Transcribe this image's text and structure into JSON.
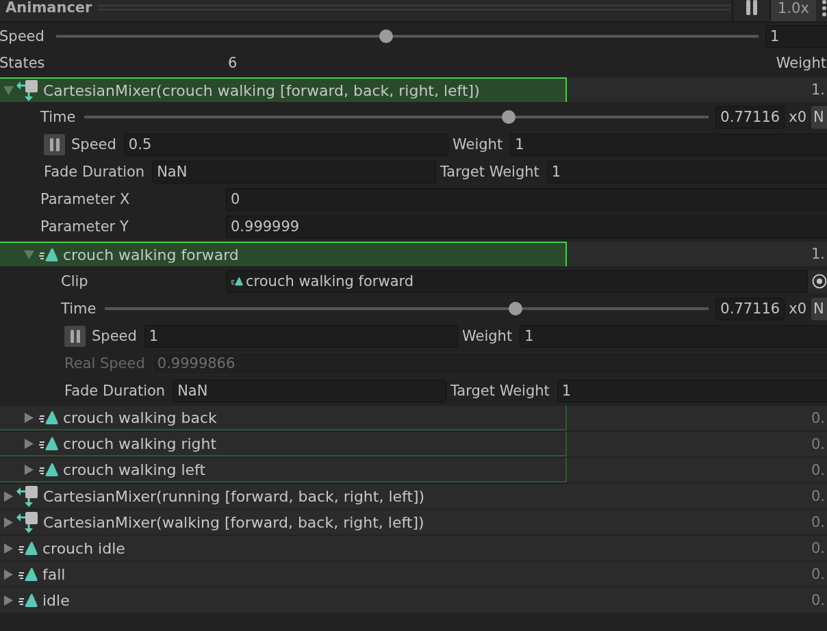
{
  "header": {
    "title": "Animancer",
    "speed_button": "1.0x"
  },
  "speed": {
    "label": "Speed",
    "level": 0.47,
    "value": "1"
  },
  "summary": {
    "label": "States",
    "count": "6",
    "weight_header": "Weight"
  },
  "states": [
    {
      "kind": "mixer",
      "name": "CartesianMixer(crouch walking [forward, back, right, left])",
      "weight": "1.",
      "expanded": true,
      "playing": true,
      "outlined": false,
      "fields": [
        {
          "kind": "time",
          "label": "Time",
          "level": 0.68,
          "value": "0.77116",
          "multiplier": "x0",
          "button": "N",
          "disabled": false
        },
        {
          "kind": "speed",
          "label": "Speed",
          "value": "0.5",
          "weight_label": "Weight",
          "weight": "1",
          "disabled": false
        },
        {
          "kind": "fade",
          "label": "Fade Duration",
          "value": "NaN",
          "target_label": "Target Weight",
          "target": "1",
          "disabled": false
        },
        {
          "kind": "parameter",
          "label": "Parameter X",
          "value": "0",
          "disabled": false
        },
        {
          "kind": "parameter",
          "label": "Parameter Y",
          "value": "0.999999",
          "disabled": false
        }
      ],
      "children": [
        {
          "kind": "clip",
          "name": "crouch walking forward",
          "weight": "1.",
          "expanded": true,
          "playing": true,
          "outlined": false,
          "fields": [
            {
              "kind": "clip",
              "label": "Clip",
              "value": "crouch walking forward",
              "disabled": false
            },
            {
              "kind": "time",
              "label": "Time",
              "level": 0.68,
              "value": "0.77116",
              "multiplier": "x0",
              "button": "N",
              "disabled": false
            },
            {
              "kind": "speed",
              "label": "Speed",
              "value": "1",
              "weight_label": "Weight",
              "weight": "1",
              "disabled": false
            },
            {
              "kind": "inline",
              "label": "Real Speed",
              "value": "0.9999866",
              "disabled": true
            },
            {
              "kind": "fade",
              "label": "Fade Duration",
              "value": "NaN",
              "target_label": "Target Weight",
              "target": "1",
              "disabled": false
            }
          ]
        },
        {
          "kind": "clip",
          "name": "crouch walking back",
          "weight": "0.",
          "expanded": false,
          "playing": false,
          "outlined": true
        },
        {
          "kind": "clip",
          "name": "crouch walking right",
          "weight": "0.",
          "expanded": false,
          "playing": false,
          "outlined": true
        },
        {
          "kind": "clip",
          "name": "crouch walking left",
          "weight": "0.",
          "expanded": false,
          "playing": false,
          "outlined": true
        }
      ]
    },
    {
      "kind": "mixer",
      "name": "CartesianMixer(running [forward, back, right, left])",
      "weight": "0.",
      "expanded": false,
      "playing": false,
      "outlined": false
    },
    {
      "kind": "mixer",
      "name": "CartesianMixer(walking [forward, back, right, left])",
      "weight": "0.",
      "expanded": false,
      "playing": false,
      "outlined": false
    },
    {
      "kind": "clip",
      "name": "crouch idle",
      "weight": "0.",
      "expanded": false,
      "playing": false,
      "outlined": false
    },
    {
      "kind": "clip",
      "name": "fall",
      "weight": "0.",
      "expanded": false,
      "playing": false,
      "outlined": false
    },
    {
      "kind": "clip",
      "name": "idle",
      "weight": "0.",
      "expanded": false,
      "playing": false,
      "outlined": false
    }
  ]
}
